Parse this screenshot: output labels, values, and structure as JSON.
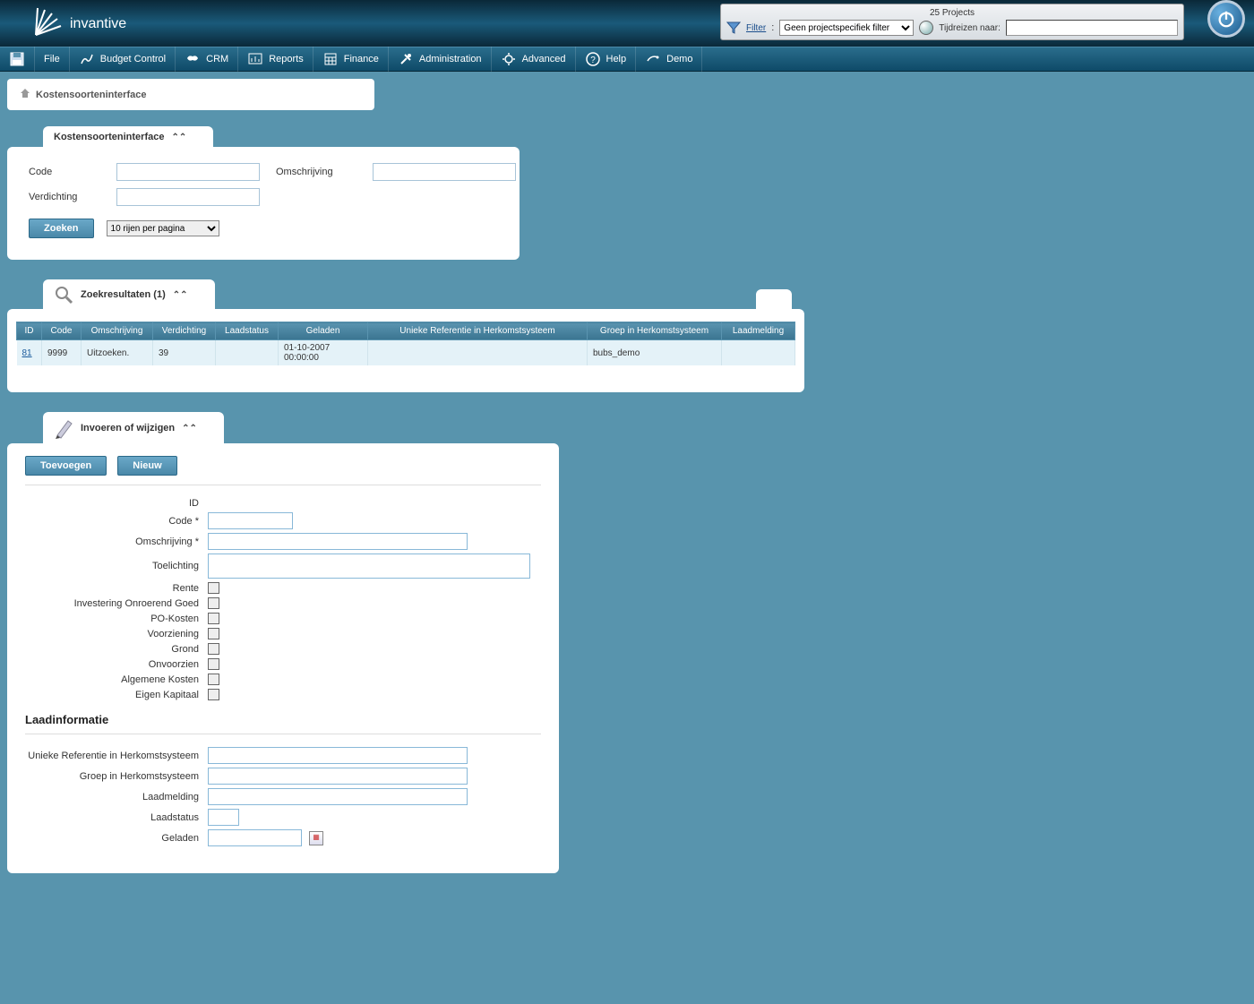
{
  "header": {
    "logo_text": "invantive",
    "projects_label": "25 Projects",
    "filter_label": "Filter",
    "filter_sep": ":",
    "filter_selected": "Geen projectspecifiek filter",
    "timetravel_label": "Tijdreizen naar:"
  },
  "menu": {
    "items": [
      "File",
      "Budget Control",
      "CRM",
      "Reports",
      "Finance",
      "Administration",
      "Advanced",
      "Help",
      "Demo"
    ]
  },
  "breadcrumb": {
    "title": "Kostensoorteninterface"
  },
  "search": {
    "tab_title": "Kostensoorteninterface",
    "labels": {
      "code": "Code",
      "omschrijving": "Omschrijving",
      "verdichting": "Verdichting"
    },
    "button": "Zoeken",
    "rows_select": "10 rijen per pagina"
  },
  "results": {
    "tab_title": "Zoekresultaten (1)",
    "headers": [
      "ID",
      "Code",
      "Omschrijving",
      "Verdichting",
      "Laadstatus",
      "Geladen",
      "Unieke Referentie in Herkomstsysteem",
      "Groep in Herkomstsysteem",
      "Laadmelding"
    ],
    "rows": [
      {
        "id": "81",
        "code": "9999",
        "omschrijving": "Uitzoeken.",
        "verdichting": "39",
        "laadstatus": "",
        "geladen": "01-10-2007 00:00:00",
        "uniekeref": "",
        "groep": "bubs_demo",
        "laadmelding": ""
      }
    ]
  },
  "edit": {
    "tab_title": "Invoeren of wijzigen",
    "btn_add": "Toevoegen",
    "btn_new": "Nieuw",
    "labels": {
      "id": "ID",
      "code": "Code *",
      "omschrijving": "Omschrijving *",
      "toelichting": "Toelichting",
      "rente": "Rente",
      "investering": "Investering Onroerend Goed",
      "pokosten": "PO-Kosten",
      "voorziening": "Voorziening",
      "grond": "Grond",
      "onvoorzien": "Onvoorzien",
      "algemene": "Algemene Kosten",
      "eigen": "Eigen Kapitaal"
    },
    "section_laad": "Laadinformatie",
    "laad_labels": {
      "uniekeref": "Unieke Referentie in Herkomstsysteem",
      "groep": "Groep in Herkomstsysteem",
      "laadmelding": "Laadmelding",
      "laadstatus": "Laadstatus",
      "geladen": "Geladen"
    }
  }
}
